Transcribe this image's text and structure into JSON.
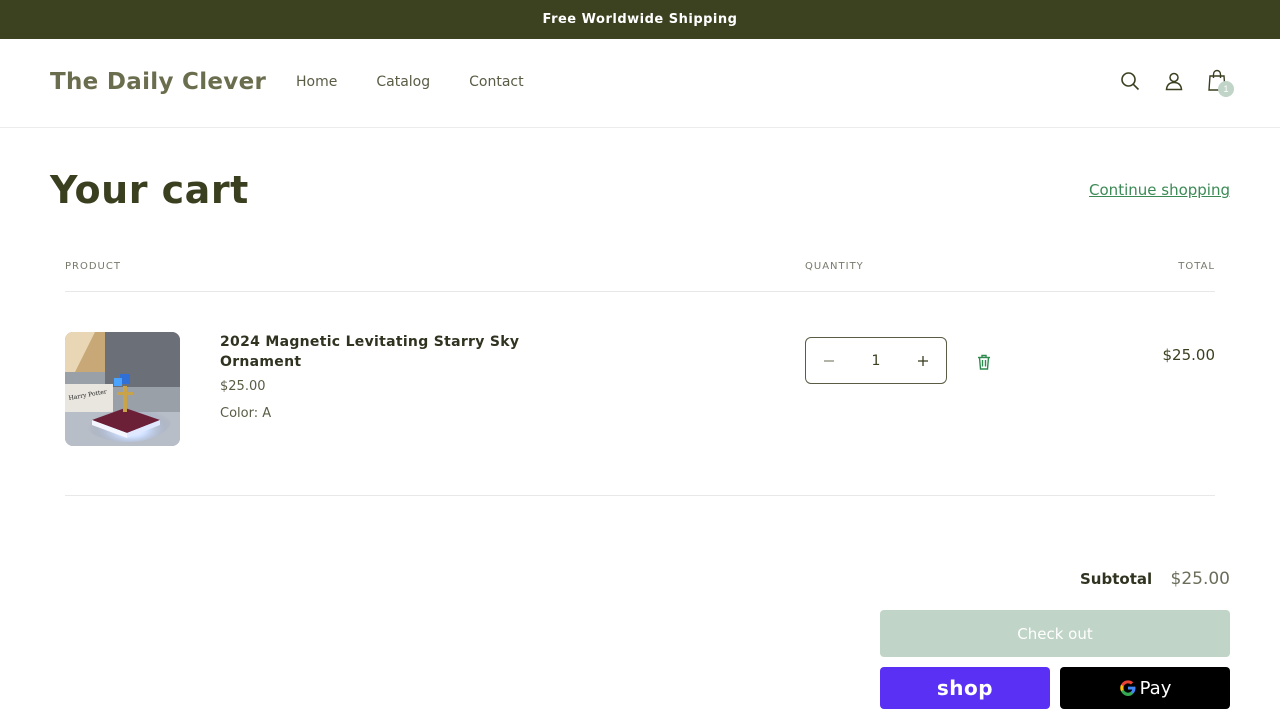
{
  "announcement": {
    "text": "Free Worldwide Shipping"
  },
  "header": {
    "logo": "The Daily Clever",
    "nav": [
      "Home",
      "Catalog",
      "Contact"
    ],
    "cart_count": "1"
  },
  "cart": {
    "title": "Your cart",
    "continue_label": "Continue shopping",
    "columns": {
      "product": "PRODUCT",
      "quantity": "QUANTITY",
      "total": "TOTAL"
    },
    "items": [
      {
        "name": "2024 Magnetic Levitating Starry Sky Ornament",
        "price": "$25.00",
        "variant": "Color: A",
        "quantity": "1",
        "line_total": "$25.00"
      }
    ],
    "subtotal_label": "Subtotal",
    "subtotal_value": "$25.00",
    "checkout_label": "Check out",
    "shop_pay_label": "shop",
    "gpay_label": "Pay"
  },
  "colors": {
    "announcement_bg": "#3c4220",
    "accent_link": "#3b8a55",
    "checkout_bg": "#c0d4c7",
    "shop_pay_bg": "#5a31f4"
  }
}
